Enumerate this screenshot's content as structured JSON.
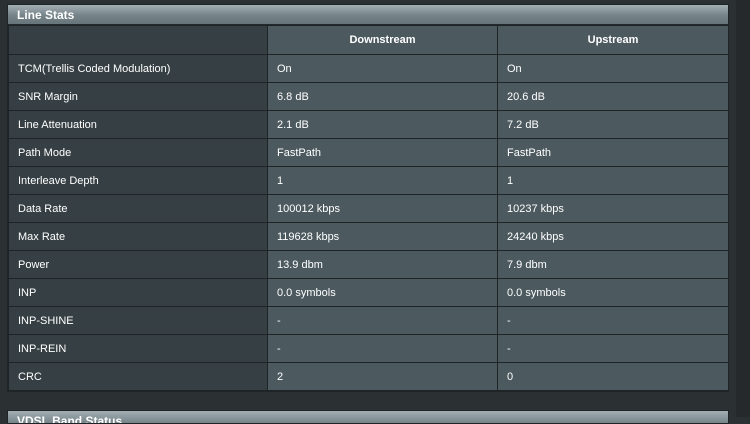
{
  "panel": {
    "title": "Line Stats",
    "columns": {
      "corner": "",
      "downstream": "Downstream",
      "upstream": "Upstream"
    },
    "rows": [
      {
        "label": "TCM(Trellis Coded Modulation)",
        "downstream": "On",
        "upstream": "On"
      },
      {
        "label": "SNR Margin",
        "downstream": "6.8 dB",
        "upstream": "20.6 dB"
      },
      {
        "label": "Line Attenuation",
        "downstream": "2.1 dB",
        "upstream": "7.2 dB"
      },
      {
        "label": "Path Mode",
        "downstream": "FastPath",
        "upstream": "FastPath"
      },
      {
        "label": "Interleave Depth",
        "downstream": "1",
        "upstream": "1"
      },
      {
        "label": "Data Rate",
        "downstream": "100012 kbps",
        "upstream": "10237 kbps"
      },
      {
        "label": "Max Rate",
        "downstream": "119628 kbps",
        "upstream": "24240 kbps"
      },
      {
        "label": "Power",
        "downstream": "13.9 dbm",
        "upstream": "7.9 dbm"
      },
      {
        "label": "INP",
        "downstream": "0.0 symbols",
        "upstream": "0.0 symbols"
      },
      {
        "label": "INP-SHINE",
        "downstream": "-",
        "upstream": "-"
      },
      {
        "label": "INP-REIN",
        "downstream": "-",
        "upstream": "-"
      },
      {
        "label": "CRC",
        "downstream": "2",
        "upstream": "0"
      }
    ]
  },
  "next_panel": {
    "title": "VDSL Band Status"
  },
  "colors": {
    "header_gradient_top": "#a3aeb2",
    "header_gradient_bottom": "#677479",
    "label_cell": "#363f43",
    "value_cell": "#4c5a60",
    "border": "#1f2527",
    "text": "#ffffff"
  }
}
